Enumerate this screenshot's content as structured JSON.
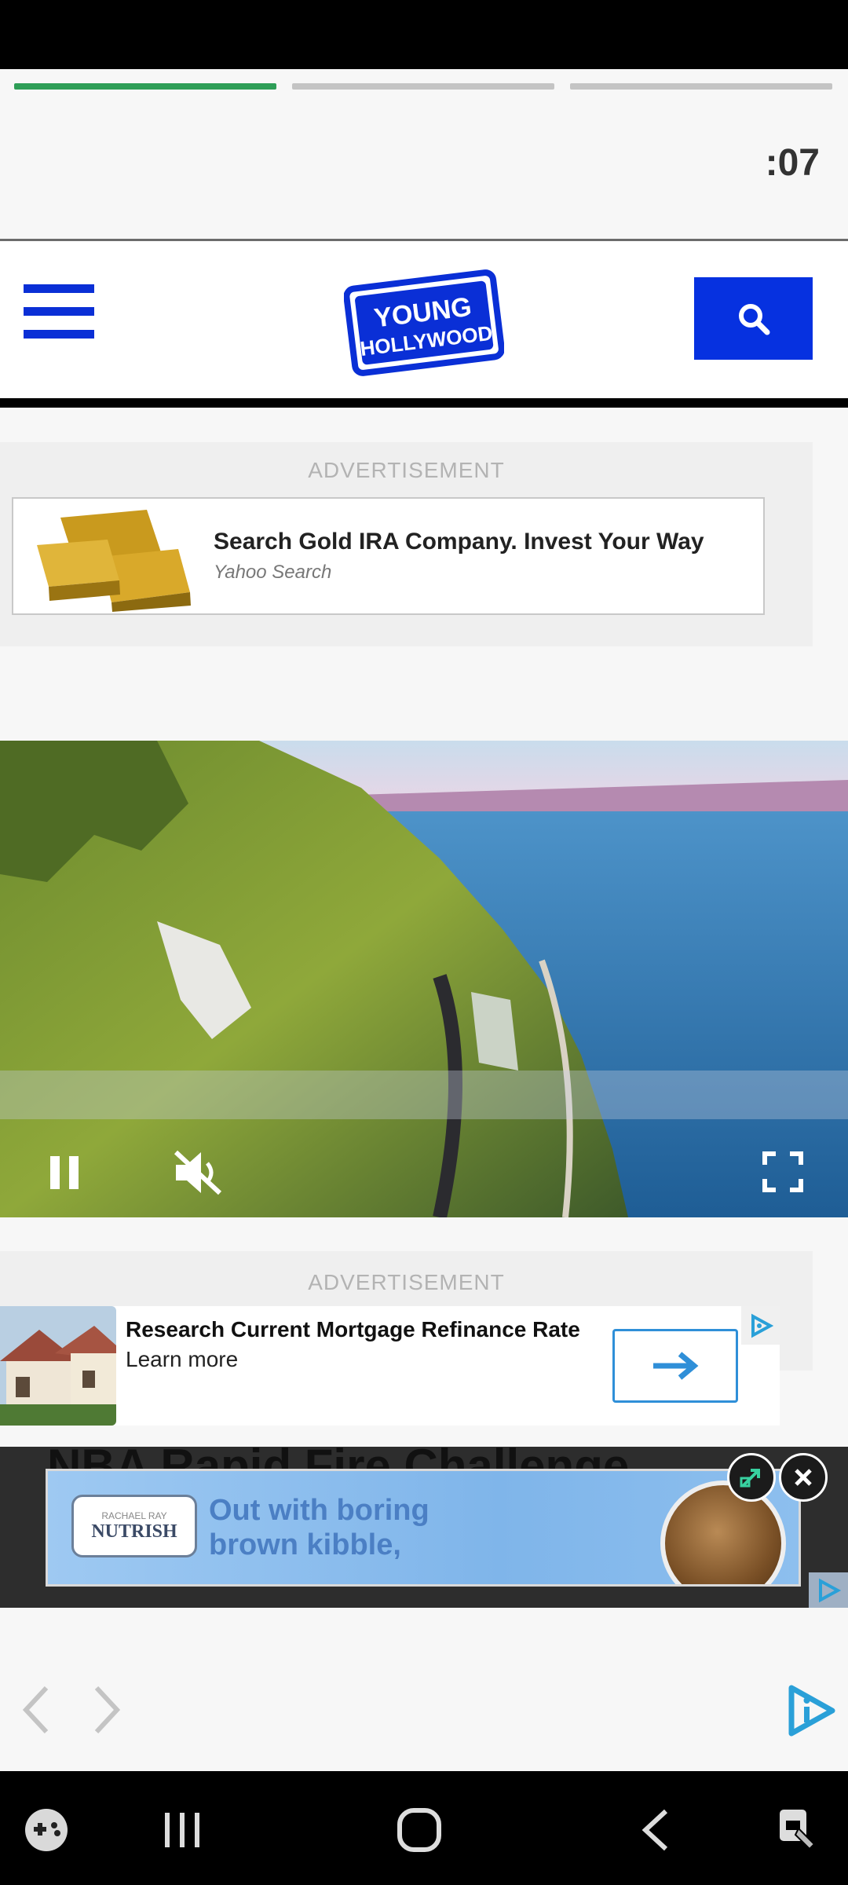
{
  "story": {
    "timer": ":07",
    "segments": 3,
    "active_segment": 1
  },
  "header": {
    "logo_line1": "YOUNG",
    "logo_line2": "HOLLYWOOD"
  },
  "ad1": {
    "label": "ADVERTISEMENT",
    "title": "Search Gold IRA Company. Invest Your Way",
    "source": "Yahoo Search"
  },
  "ad2": {
    "label": "ADVERTISEMENT",
    "title": "Research Current Mortgage Refinance Rate",
    "cta": "Learn more"
  },
  "sticky": {
    "background_headline": "NBA Rapid Fire Challenge",
    "brand_small": "RACHAEL RAY",
    "brand": "NUTRISH",
    "tagline_line1": "Out with boring",
    "tagline_line2": "brown kibble,"
  },
  "colors": {
    "brand_blue": "#0631e0",
    "progress_active": "#2e9e57",
    "adchoices_blue": "#2aa0d8"
  }
}
